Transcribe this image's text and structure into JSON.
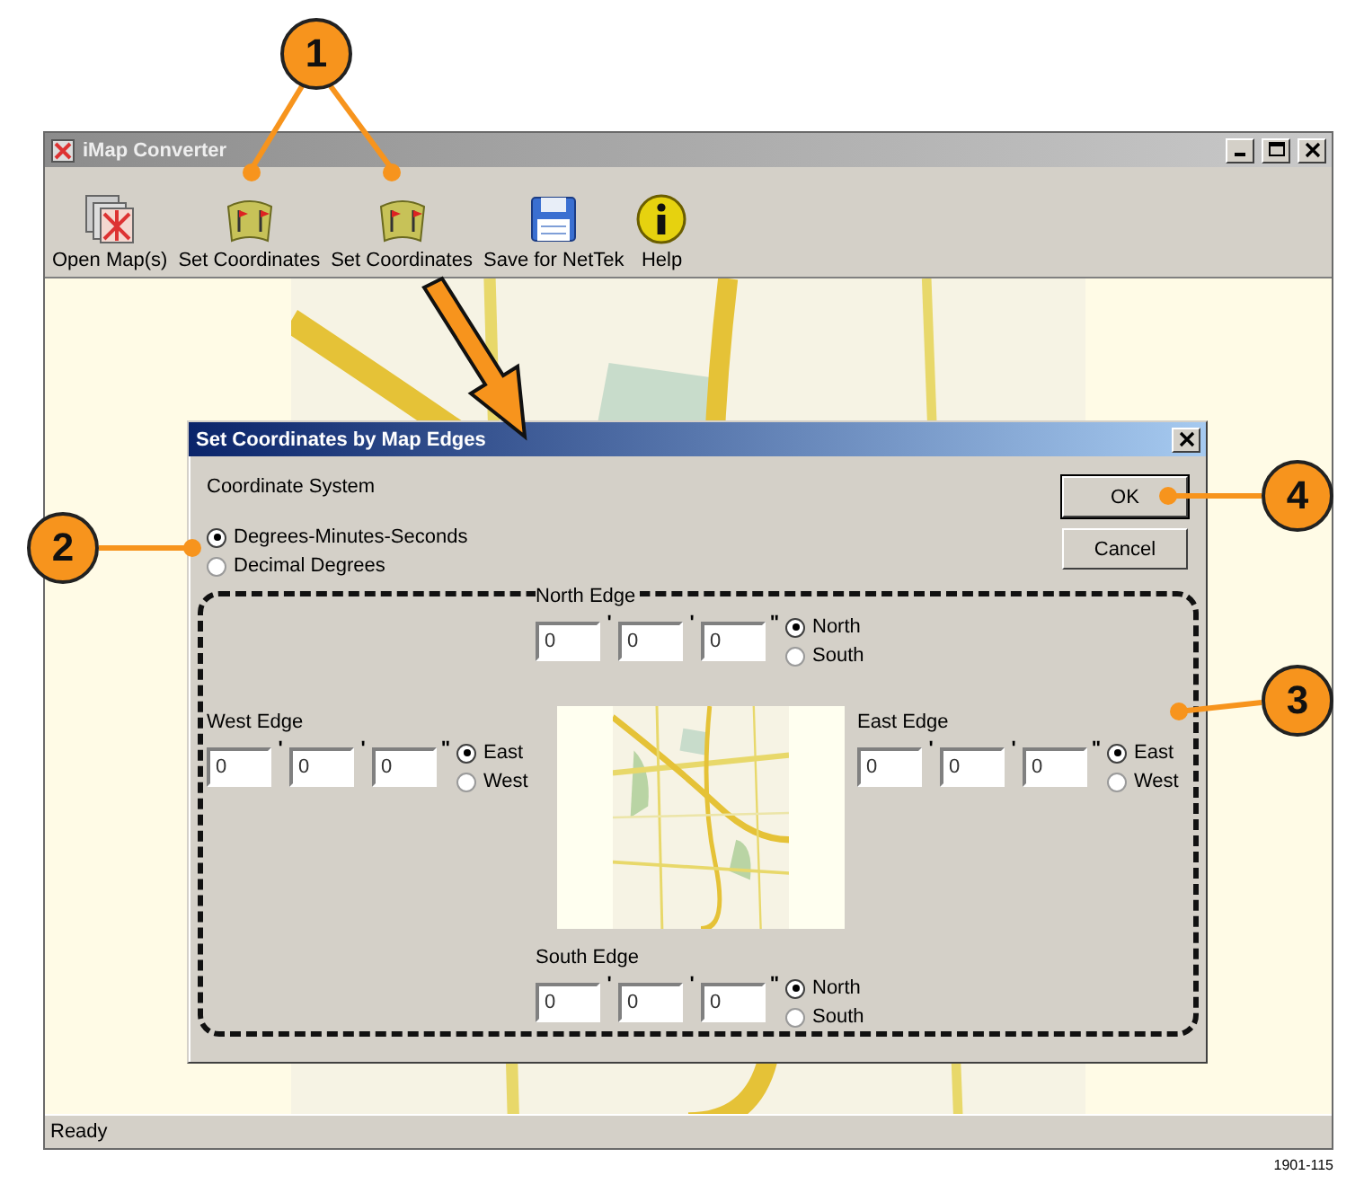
{
  "window": {
    "title": "iMap Converter"
  },
  "toolbar": [
    {
      "label": "Open Map(s)",
      "kind": "open"
    },
    {
      "label": "Set Coordinates",
      "kind": "set"
    },
    {
      "label": "Set Coordinates",
      "kind": "set"
    },
    {
      "label": "Save for NetTek",
      "kind": "save"
    },
    {
      "label": "Help",
      "kind": "help"
    }
  ],
  "status_bar": "Ready",
  "dialog": {
    "title": "Set Coordinates by Map Edges",
    "section_label": "Coordinate System",
    "options": [
      {
        "label": "Degrees-Minutes-Seconds",
        "selected": true
      },
      {
        "label": "Decimal Degrees",
        "selected": false
      }
    ],
    "buttons": [
      "OK",
      "Cancel"
    ],
    "edges": [
      {
        "kind": "north",
        "label": "North Edge",
        "fields": [
          {
            "value": "0",
            "unit": "'"
          },
          {
            "value": "0",
            "unit": "'"
          },
          {
            "value": "0",
            "unit": "\""
          }
        ],
        "options": [
          {
            "label": "North",
            "selected": true
          },
          {
            "label": "South",
            "selected": false
          }
        ]
      },
      {
        "kind": "west",
        "label": "West Edge",
        "fields": [
          {
            "value": "0",
            "unit": "'"
          },
          {
            "value": "0",
            "unit": "'"
          },
          {
            "value": "0",
            "unit": "\""
          }
        ],
        "options": [
          {
            "label": "East",
            "selected": true
          },
          {
            "label": "West",
            "selected": false
          }
        ]
      },
      {
        "kind": "east",
        "label": "East Edge",
        "fields": [
          {
            "value": "0",
            "unit": "'"
          },
          {
            "value": "0",
            "unit": "'"
          },
          {
            "value": "0",
            "unit": "\""
          }
        ],
        "options": [
          {
            "label": "East",
            "selected": true
          },
          {
            "label": "West",
            "selected": false
          }
        ]
      },
      {
        "kind": "south",
        "label": "South Edge",
        "fields": [
          {
            "value": "0",
            "unit": "'"
          },
          {
            "value": "0",
            "unit": "'"
          },
          {
            "value": "0",
            "unit": "\""
          }
        ],
        "options": [
          {
            "label": "North",
            "selected": true
          },
          {
            "label": "South",
            "selected": false
          }
        ]
      }
    ]
  },
  "callouts": [
    {
      "number": "1"
    },
    {
      "number": "2"
    },
    {
      "number": "3"
    },
    {
      "number": "4"
    }
  ],
  "figure_id": "1901-115"
}
